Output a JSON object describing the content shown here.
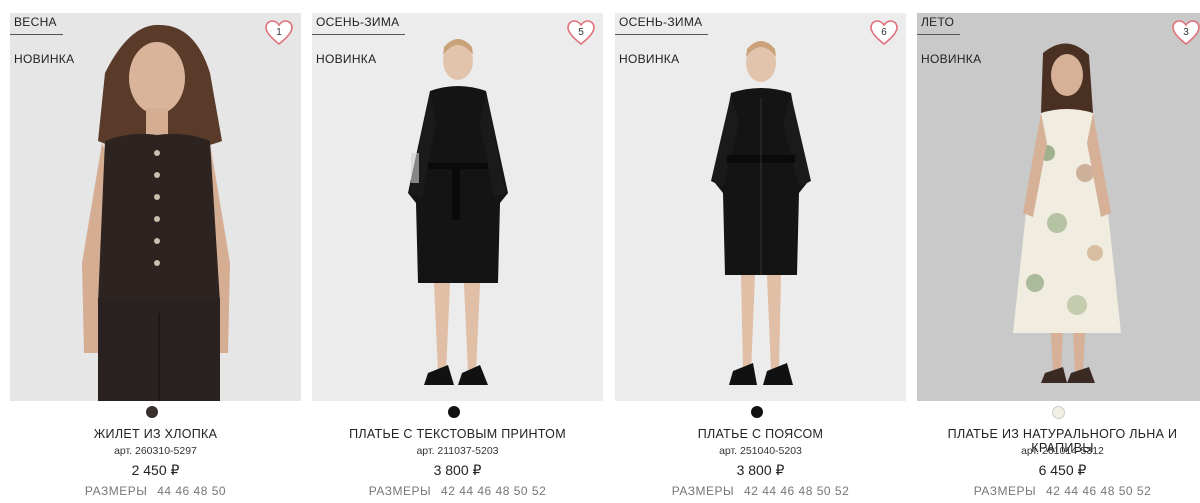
{
  "products": [
    {
      "season": "ВЕСНА",
      "badge": "НОВИНКА",
      "favorites": "1",
      "color": "#3a2f2c",
      "title": "ЖИЛЕТ ИЗ ХЛОПКА",
      "article": "арт. 260310-5297",
      "price": "2 450 ₽",
      "sizes_label": "РАЗМЕРЫ",
      "sizes": "44 46 48 50",
      "bg": "#e6e6e6"
    },
    {
      "season": "ОСЕНЬ-ЗИМА",
      "badge": "НОВИНКА",
      "favorites": "5",
      "color": "#111111",
      "title": "ПЛАТЬЕ С ТЕКСТОВЫМ ПРИНТОМ",
      "article": "арт. 211037-5203",
      "price": "3 800 ₽",
      "sizes_label": "РАЗМЕРЫ",
      "sizes": "42 44 46 48 50 52",
      "bg": "#ececec"
    },
    {
      "season": "ОСЕНЬ-ЗИМА",
      "badge": "НОВИНКА",
      "favorites": "6",
      "color": "#111111",
      "title": "ПЛАТЬЕ С ПОЯСОМ",
      "article": "арт. 251040-5203",
      "price": "3 800 ₽",
      "sizes_label": "РАЗМЕРЫ",
      "sizes": "42 44 46 48 50 52",
      "bg": "#ececec"
    },
    {
      "season": "ЛЕТО",
      "badge": "НОВИНКА",
      "favorites": "3",
      "color": "#f1eee4",
      "title": "ПЛАТЬЕ ИЗ НАТУРАЛЬНОГО ЛЬНА И КРАПИВЫ",
      "article": "арт. 261014-5312",
      "price": "6 450 ₽",
      "sizes_label": "РАЗМЕРЫ",
      "sizes": "42 44 46 48 50 52",
      "bg": "#c9c9c9"
    }
  ],
  "icons": {
    "favorite": "heart-icon"
  },
  "accent": "#e0707a"
}
